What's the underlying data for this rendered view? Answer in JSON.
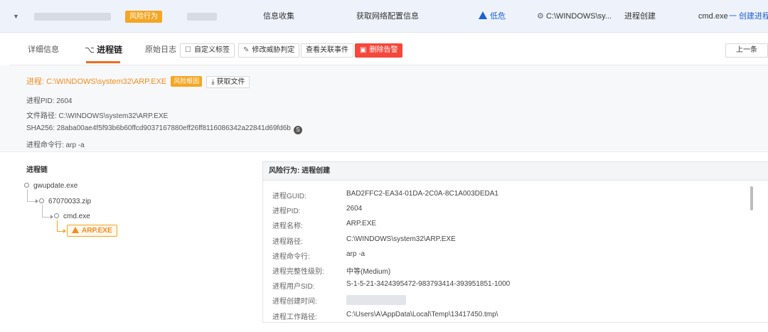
{
  "summary": {
    "risk_tag": "风险行为",
    "category": "信息收集",
    "behavior": "获取网络配置信息",
    "level": "低危",
    "path": "C:\\WINDOWS\\sy...",
    "action": "进程创建",
    "process": "cmd.exe",
    "link": "一 创建进程 -"
  },
  "tabs": {
    "details": "详细信息",
    "chain": "进程链",
    "raw_log": "原始日志",
    "custom_tag": "自定义标签",
    "modify_threat": "修改威胁判定",
    "view_related": "查看关联事件",
    "delete_alert": "删除告警",
    "prev": "上一条"
  },
  "info": {
    "title": "进程: C:\\WINDOWS\\system32\\ARP.EXE",
    "risk_tag": "风险根因",
    "get_file": "获取文件",
    "pid": "进程PID: 2604",
    "file_path": "文件路径: C:\\WINDOWS\\system32\\ARP.EXE",
    "sha256": "SHA256: 28aba00ae4f5f93b6b60ffcd9037167880eff26ff8116086342a22841d69fd6b",
    "s_badge": "S",
    "cmdline": "进程命令行: arp -a"
  },
  "chain": {
    "label": "进程链",
    "nodes": [
      "gwupdate.exe",
      "67070033.zip",
      "cmd.exe",
      "ARP.EXE"
    ]
  },
  "panel": {
    "header": "风险行为: 进程创建",
    "rows": [
      {
        "k": "进程GUID:",
        "v": "BAD2FFC2-EA34-01DA-2C0A-8C1A003DEDA1"
      },
      {
        "k": "进程PID:",
        "v": "2604"
      },
      {
        "k": "进程名称:",
        "v": "ARP.EXE"
      },
      {
        "k": "进程路径:",
        "v": "C:\\WINDOWS\\system32\\ARP.EXE"
      },
      {
        "k": "进程命令行:",
        "v": "arp -a"
      },
      {
        "k": "进程完整性级别:",
        "v": "中等(Medium)"
      },
      {
        "k": "进程用户SID:",
        "v": "S-1-5-21-3424395472-983793414-393951851-1000"
      },
      {
        "k": "进程创建时间:",
        "v": ""
      },
      {
        "k": "进程工作路径:",
        "v": "C:\\Users\\A\\AppData\\Local\\Temp\\13417450.tmp\\"
      }
    ]
  },
  "colors": {
    "accent_orange": "#f26b1d",
    "risk_orange": "#f5a623",
    "link_blue": "#1f5fd1",
    "danger": "#f5483b"
  }
}
